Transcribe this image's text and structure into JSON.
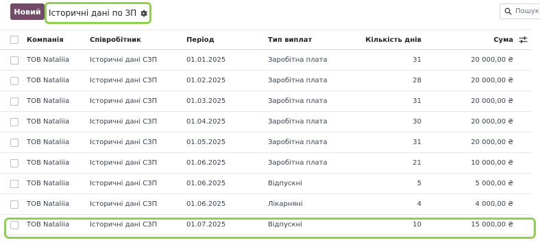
{
  "toolbar": {
    "new_label": "Новий",
    "title": "Історичні дані по ЗП",
    "search_placeholder": "Пошук..."
  },
  "columns": {
    "company": "Компанія",
    "employee": "Співробітник",
    "period": "Період",
    "payment_type": "Тип виплат",
    "days": "Кількість днів",
    "sum": "Сума"
  },
  "rows": [
    {
      "company": "ТОВ Nataliia",
      "employee": "Історичні дані СЗП",
      "period": "01.01.2025",
      "payment_type": "Заробітна плата",
      "days": "31",
      "sum": "20 000,00 ₴"
    },
    {
      "company": "ТОВ Nataliia",
      "employee": "Історичні дані СЗП",
      "period": "01.02.2025",
      "payment_type": "Заробітна плата",
      "days": "28",
      "sum": "20 000,00 ₴"
    },
    {
      "company": "ТОВ Nataliia",
      "employee": "Історичні дані СЗП",
      "period": "01.03.2025",
      "payment_type": "Заробітна плата",
      "days": "31",
      "sum": "20 000,00 ₴"
    },
    {
      "company": "ТОВ Nataliia",
      "employee": "Історичні дані СЗП",
      "period": "01.04.2025",
      "payment_type": "Заробітна плата",
      "days": "30",
      "sum": "20 000,00 ₴"
    },
    {
      "company": "ТОВ Nataliia",
      "employee": "Історичні дані СЗП",
      "period": "01.05.2025",
      "payment_type": "Заробітна плата",
      "days": "31",
      "sum": "20 000,00 ₴"
    },
    {
      "company": "ТОВ Nataliia",
      "employee": "Історичні дані СЗП",
      "period": "01.06.2025",
      "payment_type": "Заробітна плата",
      "days": "21",
      "sum": "10 000,00 ₴"
    },
    {
      "company": "ТОВ Nataliia",
      "employee": "Історичні дані СЗП",
      "period": "01.06.2025",
      "payment_type": "Відпускні",
      "days": "5",
      "sum": "5 000,00 ₴"
    },
    {
      "company": "ТОВ Nataliia",
      "employee": "Історичні дані СЗП",
      "period": "01.06.2025",
      "payment_type": "Лікарняні",
      "days": "4",
      "sum": "4 000,00 ₴"
    },
    {
      "company": "ТОВ Nataliia",
      "employee": "Історичні дані СЗП",
      "period": "01.07.2025",
      "payment_type": "Відпускні",
      "days": "10",
      "sum": "15 000,00 ₴"
    }
  ],
  "colors": {
    "brand": "#714b67",
    "highlight": "#8fd14f"
  },
  "icons": {
    "gear": "gear-icon",
    "search": "search-icon",
    "column_settings": "sliders-icon"
  }
}
